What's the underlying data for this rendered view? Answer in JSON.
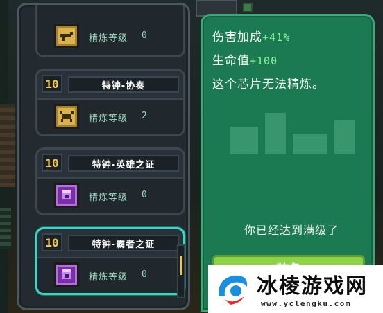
{
  "chip_list": {
    "refine_label": "精炼等级",
    "items": [
      {
        "level": "",
        "name": "",
        "icon": "gold-gun-chip-icon",
        "refine_level": "0",
        "selected": false
      },
      {
        "level": "10",
        "name": "特钟-协奏",
        "icon": "gold-crab-chip-icon",
        "refine_level": "2",
        "selected": false
      },
      {
        "level": "10",
        "name": "特钟-英雄之证",
        "icon": "purple-armor-chip-icon",
        "refine_level": "0",
        "selected": false
      },
      {
        "level": "10",
        "name": "特钟-霸者之证",
        "icon": "purple-armor-chip-icon",
        "refine_level": "0",
        "selected": true
      }
    ]
  },
  "detail": {
    "damage_label": "伤害加成",
    "damage_bonus": "+41%",
    "hp_label": "生命值",
    "hp_bonus": "+100",
    "note": "这个芯片无法精炼。",
    "max_level_text": "你已经达到满级了",
    "equip_button": "装备"
  },
  "watermark": {
    "title": "冰棱游戏网",
    "url": "www.yclengku.com"
  },
  "colors": {
    "detail_panel": "#1c7a52",
    "accent_bonus": "#8df39c",
    "level_badge": "#f2c64a",
    "selected_border": "#3fd4c4",
    "equip_button": "#8ed24a"
  }
}
